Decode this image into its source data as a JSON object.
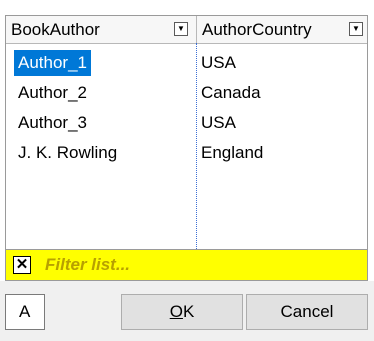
{
  "columns": [
    {
      "label": "BookAuthor",
      "dropdown_icon": "chevron-down-icon"
    },
    {
      "label": "AuthorCountry",
      "dropdown_icon": "chevron-down-icon"
    }
  ],
  "rows": [
    {
      "author": "Author_1",
      "country": "USA",
      "selected": true
    },
    {
      "author": "Author_2",
      "country": "Canada",
      "selected": false
    },
    {
      "author": "Author_3",
      "country": "USA",
      "selected": false
    },
    {
      "author": "J. K. Rowling",
      "country": "England",
      "selected": false
    }
  ],
  "filter": {
    "clear_glyph": "✕",
    "placeholder": "Filter list..."
  },
  "buttons": {
    "a_label": "A",
    "ok_mnemonic": "O",
    "ok_rest": "K",
    "cancel_label": "Cancel"
  },
  "colors": {
    "selection": "#0078d7",
    "filter_background": "#ffff00",
    "filter_text": "#b7a100"
  }
}
